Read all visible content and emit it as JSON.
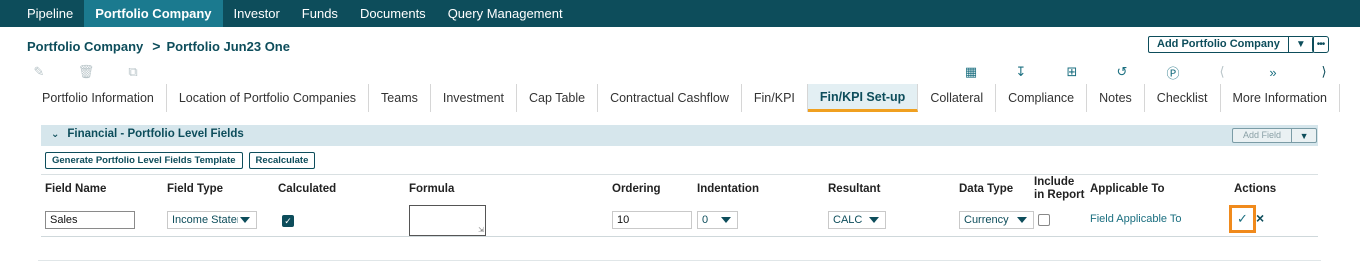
{
  "nav": [
    "Pipeline",
    "Portfolio Company",
    "Investor",
    "Funds",
    "Documents",
    "Query Management"
  ],
  "breadcrumb": {
    "root": "Portfolio Company",
    "separator": ">",
    "current": "Portfolio Jun23 One"
  },
  "header_actions": {
    "add_button": "Add Portfolio Company",
    "dropdown_icon": "chevron-down-icon",
    "more_icon": "ellipsis-icon"
  },
  "toolbar": {
    "left_icons": [
      "edit-icon",
      "delete-icon",
      "copy-icon"
    ],
    "right_icons": [
      "calendar-import-icon",
      "download-doc-icon",
      "add-doc-icon",
      "history-icon",
      "currency-icon",
      "prev-icon",
      "fast-forward-icon",
      "next-icon"
    ]
  },
  "tabs": [
    "Portfolio Information",
    "Location of Portfolio Companies",
    "Teams",
    "Investment",
    "Cap Table",
    "Contractual Cashflow",
    "Fin/KPI",
    "Fin/KPI Set-up",
    "Collateral",
    "Compliance",
    "Notes",
    "Checklist",
    "More Information"
  ],
  "active_tab": "Fin/KPI Set-up",
  "panel": {
    "title": "Financial - Portfolio Level Fields",
    "add_field": "Add Field",
    "buttons": {
      "generate": "Generate Portfolio Level Fields Template",
      "recalculate": "Recalculate"
    }
  },
  "table": {
    "headers": {
      "field_name": "Field Name",
      "field_type": "Field Type",
      "calculated": "Calculated",
      "formula": "Formula",
      "ordering": "Ordering",
      "indentation": "Indentation",
      "resultant": "Resultant",
      "data_type": "Data Type",
      "include": "Include in Report",
      "applicable": "Applicable To",
      "actions": "Actions"
    },
    "row": {
      "field_name": "Sales",
      "field_type": "Income Statement",
      "calculated": true,
      "formula": "",
      "ordering": "10",
      "indentation": "0",
      "resultant": "CALC",
      "data_type": "Currency",
      "include": false,
      "applicable": "Field Applicable To"
    }
  },
  "colors": {
    "nav_bg": "#0d4d5b",
    "nav_active": "#1b7a8f",
    "accent": "#f08a1c",
    "panel_header": "#d6e6ec"
  }
}
